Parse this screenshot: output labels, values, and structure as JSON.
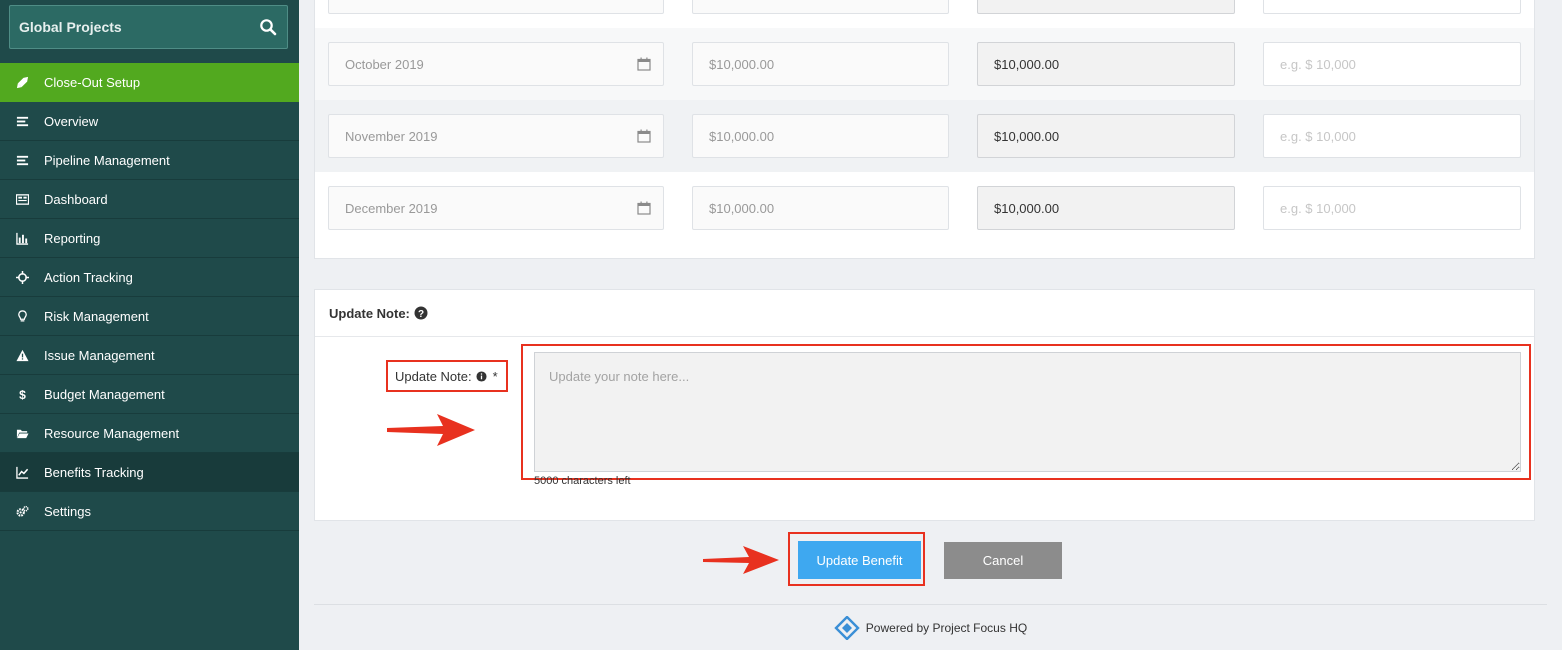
{
  "sidebar": {
    "title": "Global Projects",
    "items": [
      {
        "label": "Close-Out Setup",
        "icon": "rocket-icon"
      },
      {
        "label": "Overview",
        "icon": "list-icon"
      },
      {
        "label": "Pipeline Management",
        "icon": "list-icon"
      },
      {
        "label": "Dashboard",
        "icon": "dashboard-icon"
      },
      {
        "label": "Reporting",
        "icon": "bar-chart-icon"
      },
      {
        "label": "Action Tracking",
        "icon": "crosshair-icon"
      },
      {
        "label": "Risk Management",
        "icon": "lightbulb-icon"
      },
      {
        "label": "Issue Management",
        "icon": "warning-icon"
      },
      {
        "label": "Budget Management",
        "icon": "dollar-icon"
      },
      {
        "label": "Resource Management",
        "icon": "folder-icon"
      },
      {
        "label": "Benefits Tracking",
        "icon": "line-chart-icon"
      },
      {
        "label": "Settings",
        "icon": "gears-icon"
      }
    ]
  },
  "benefit_rows": [
    {
      "month": "October 2019",
      "planned": "$10,000.00",
      "forecast": "$10,000.00",
      "actual_placeholder": "e.g. $ 10,000"
    },
    {
      "month": "November 2019",
      "planned": "$10,000.00",
      "forecast": "$10,000.00",
      "actual_placeholder": "e.g. $ 10,000"
    },
    {
      "month": "December 2019",
      "planned": "$10,000.00",
      "forecast": "$10,000.00",
      "actual_placeholder": "e.g. $ 10,000"
    }
  ],
  "note_section": {
    "heading": "Update Note:",
    "field_label": "Update Note:",
    "required_mark": "*",
    "placeholder": "Update your note here...",
    "chars_left": "5000 characters left"
  },
  "buttons": {
    "update": "Update Benefit",
    "cancel": "Cancel"
  },
  "footer": {
    "text": "Powered by Project Focus HQ"
  },
  "colors": {
    "sidebar_bg": "#1f4a4a",
    "active_item": "#52a91f",
    "primary_button": "#3ea8f0",
    "cancel_button": "#8c8c8c",
    "highlight": "#e8311f"
  }
}
